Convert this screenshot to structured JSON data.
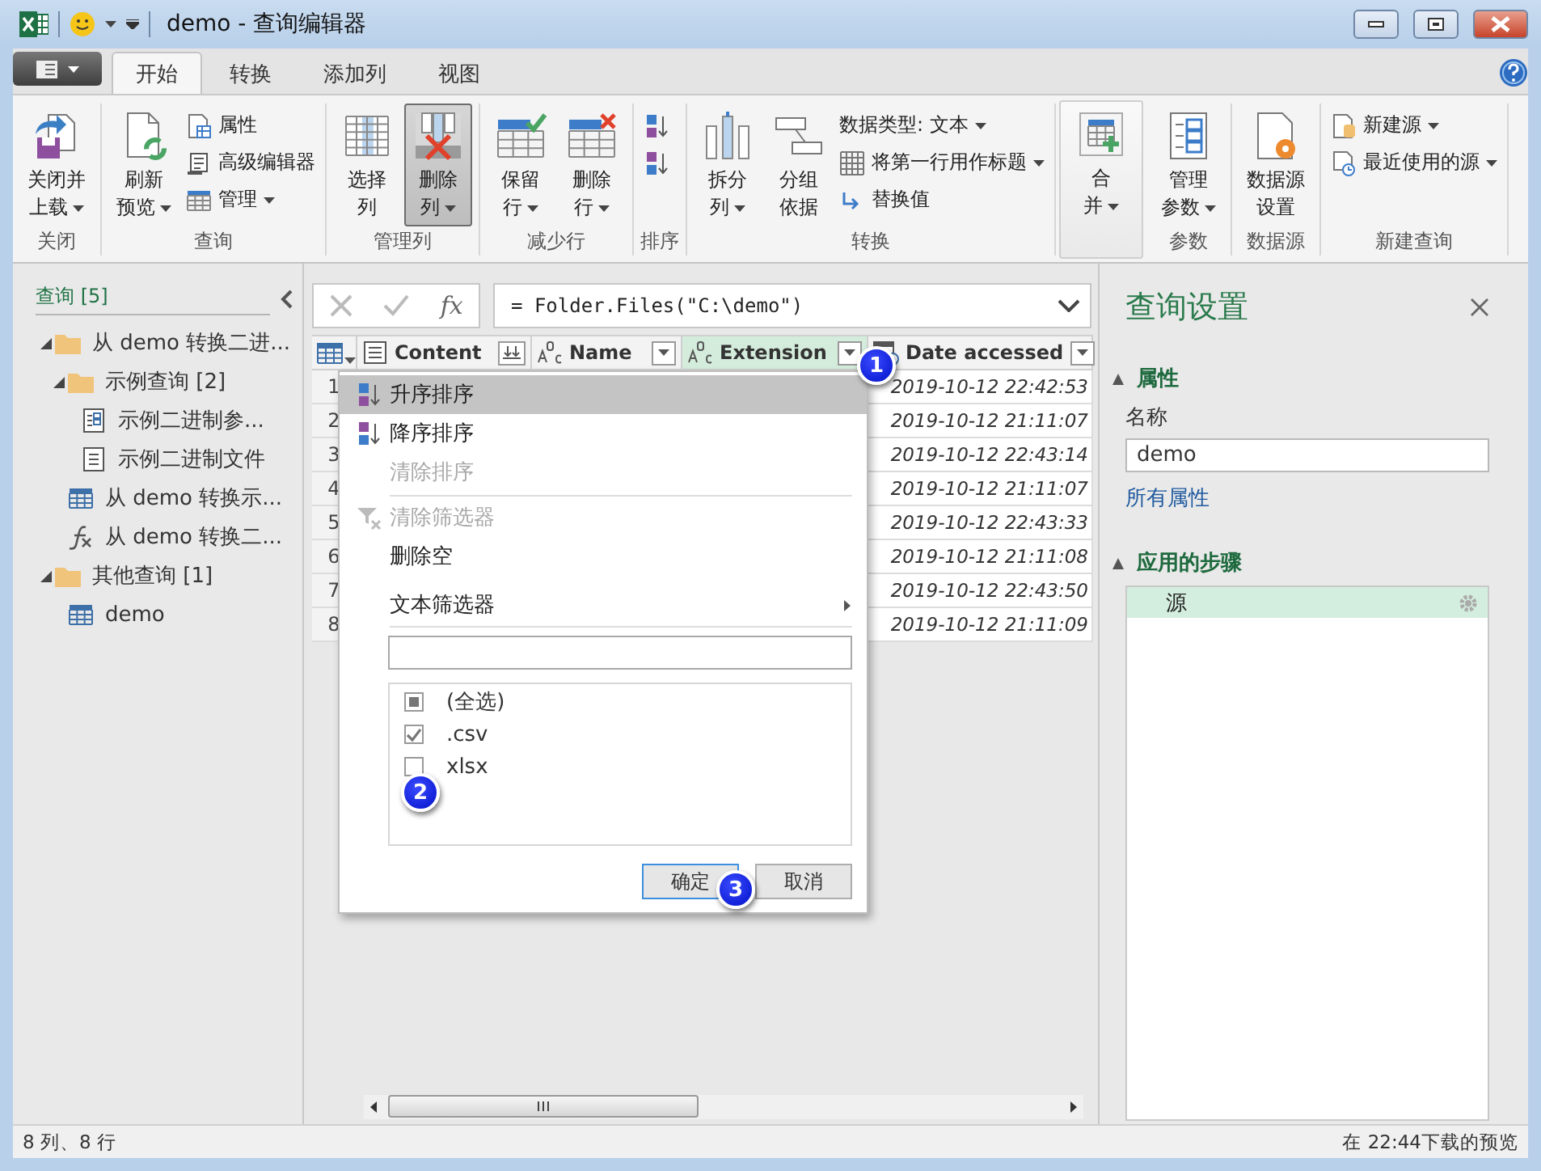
{
  "window": {
    "title": "demo - 查询编辑器"
  },
  "tabs": [
    {
      "label": "开始",
      "selected": true
    },
    {
      "label": "转换",
      "selected": false
    },
    {
      "label": "添加列",
      "selected": false
    },
    {
      "label": "视图",
      "selected": false
    }
  ],
  "ribbon": {
    "groups": [
      {
        "label": "关闭",
        "highlighted": false,
        "items": [
          {
            "kind": "large",
            "lines": [
              "关闭并",
              "上载"
            ],
            "dropdown": true,
            "pressed": false
          }
        ]
      },
      {
        "label": "查询",
        "highlighted": false,
        "items": [
          {
            "kind": "large",
            "lines": [
              "刷新",
              "预览"
            ],
            "dropdown": true,
            "pressed": false
          },
          {
            "kind": "stack",
            "rows": [
              {
                "label": "属性",
                "dropdown": false
              },
              {
                "label": "高级编辑器",
                "dropdown": false
              },
              {
                "label": "管理",
                "dropdown": true
              }
            ]
          }
        ]
      },
      {
        "label": "管理列",
        "highlighted": false,
        "items": [
          {
            "kind": "large",
            "lines": [
              "选择",
              "列"
            ],
            "dropdown": false,
            "pressed": false
          },
          {
            "kind": "large",
            "lines": [
              "删除",
              "列"
            ],
            "dropdown": true,
            "pressed": true
          }
        ]
      },
      {
        "label": "减少行",
        "highlighted": false,
        "items": [
          {
            "kind": "large",
            "lines": [
              "保留",
              "行"
            ],
            "dropdown": true,
            "pressed": false
          },
          {
            "kind": "large",
            "lines": [
              "删除",
              "行"
            ],
            "dropdown": true,
            "pressed": false
          }
        ]
      },
      {
        "label": "排序",
        "highlighted": false,
        "items": [
          {
            "kind": "stack",
            "rows": [
              {
                "dropdown": false
              },
              {
                "dropdown": false
              }
            ]
          }
        ]
      },
      {
        "label": "转换",
        "highlighted": false,
        "items": [
          {
            "kind": "large",
            "lines": [
              "拆分",
              "列"
            ],
            "dropdown": true,
            "pressed": false
          },
          {
            "kind": "large",
            "lines": [
              "分组",
              "依据"
            ],
            "dropdown": false,
            "pressed": false
          },
          {
            "kind": "stack",
            "rows": [
              {
                "label": "数据类型: 文本",
                "dropdown": true
              },
              {
                "label": "将第一行用作标题",
                "dropdown": true
              },
              {
                "label": "替换值",
                "dropdown": false
              }
            ]
          }
        ]
      },
      {
        "highlighted": true,
        "items": [
          {
            "kind": "large",
            "lines": [
              "合",
              "并"
            ],
            "dropdown": true,
            "pressed": false
          }
        ]
      },
      {
        "label": "参数",
        "highlighted": false,
        "items": [
          {
            "kind": "large",
            "lines": [
              "管理",
              "参数"
            ],
            "dropdown": true,
            "pressed": false
          }
        ]
      },
      {
        "label": "数据源",
        "highlighted": false,
        "items": [
          {
            "kind": "large",
            "lines": [
              "数据源",
              "设置"
            ],
            "dropdown": false,
            "pressed": false
          }
        ]
      },
      {
        "label": "新建查询",
        "highlighted": false,
        "items": [
          {
            "kind": "stack",
            "rows": [
              {
                "label": "新建源",
                "dropdown": true
              },
              {
                "label": "最近使用的源",
                "dropdown": true
              }
            ]
          }
        ]
      }
    ]
  },
  "queries": {
    "header": "查询 [5]",
    "items": [
      {
        "kind": "folder",
        "label": "从 demo 转换二进...",
        "expanded": true,
        "children": [
          {
            "kind": "folder",
            "label": "示例查询 [2]",
            "expanded": true,
            "children": [
              {
                "kind": "parameter",
                "label": "示例二进制参..."
              },
              {
                "kind": "file",
                "label": "示例二进制文件"
              }
            ]
          },
          {
            "kind": "table",
            "label": "从 demo 转换示..."
          },
          {
            "kind": "function",
            "label": "从 demo 转换二..."
          }
        ]
      },
      {
        "kind": "folder",
        "label": "其他查询 [1]",
        "expanded": true,
        "children": [
          {
            "kind": "table",
            "label": "demo"
          }
        ]
      }
    ]
  },
  "formula_bar": {
    "function_label": "fx",
    "formula": "= Folder.Files(\"C:\\demo\")"
  },
  "table": {
    "columns": [
      {
        "name": "Content",
        "kind": "binary",
        "selected": false,
        "expand_button": true
      },
      {
        "name": "Name",
        "kind": "text",
        "selected": false
      },
      {
        "name": "Extension",
        "kind": "text",
        "selected": true
      },
      {
        "name": "Date accessed",
        "kind": "datetime",
        "selected": false
      }
    ],
    "rows": [
      {
        "number": "1",
        "date_accessed": "2019-10-12 22:42:53"
      },
      {
        "number": "2",
        "date_accessed": "2019-10-12 21:11:07"
      },
      {
        "number": "3",
        "date_accessed": "2019-10-12 22:43:14"
      },
      {
        "number": "4",
        "date_accessed": "2019-10-12 21:11:07"
      },
      {
        "number": "5",
        "date_accessed": "2019-10-12 22:43:33"
      },
      {
        "number": "6",
        "date_accessed": "2019-10-12 21:11:08"
      },
      {
        "number": "7",
        "date_accessed": "2019-10-12 22:43:50"
      },
      {
        "number": "8",
        "date_accessed": "2019-10-12 21:11:09"
      }
    ]
  },
  "filter_menu": {
    "items": [
      {
        "kind": "sort_ascending",
        "label": "升序排序",
        "hover": true,
        "disabled": false
      },
      {
        "kind": "sort_descending",
        "label": "降序排序",
        "hover": false,
        "disabled": false
      },
      {
        "kind": "plain",
        "label": "清除排序",
        "hover": false,
        "disabled": true
      },
      {
        "kind": "separator"
      },
      {
        "kind": "clear_filter",
        "label": "清除筛选器",
        "hover": false,
        "disabled": true
      },
      {
        "kind": "plain",
        "label": "删除空",
        "hover": false,
        "disabled": false
      },
      {
        "kind": "submenu",
        "label": "文本筛选器",
        "hover": false,
        "disabled": false
      }
    ],
    "values": [
      {
        "label": "(全选)",
        "checked": false,
        "partial": true
      },
      {
        "label": ".csv",
        "checked": true,
        "partial": false
      },
      {
        "label": "xlsx",
        "checked": false,
        "partial": false
      }
    ],
    "buttons": [
      {
        "label": "确定",
        "default": true
      },
      {
        "label": "取消",
        "default": false
      }
    ]
  },
  "annotations": [
    {
      "label": "1"
    },
    {
      "label": "2"
    },
    {
      "label": "3"
    }
  ],
  "settings": {
    "title": "查询设置",
    "properties": {
      "heading": "属性",
      "expanded": true,
      "name_label": "名称",
      "name_value": "demo",
      "link": "所有属性"
    },
    "steps": {
      "heading": "应用的步骤",
      "expanded": true,
      "items": [
        {
          "label": "源",
          "selected": true
        }
      ]
    }
  },
  "status_bar": {
    "left": "8 列、8 行",
    "right": "在 22:44下载的预览"
  }
}
